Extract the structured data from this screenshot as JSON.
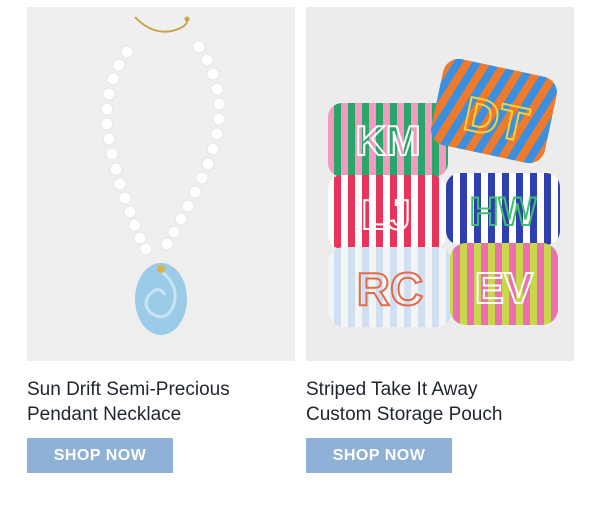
{
  "products": [
    {
      "name_line1": "Sun Drift Semi-Precious",
      "name_line2": "Pendant Necklace",
      "cta": "SHOP NOW",
      "image_icon": "necklace-photo"
    },
    {
      "name_line1": "Striped Take It Away",
      "name_line2": "Custom Storage Pouch",
      "cta": "SHOP NOW",
      "image_icon": "pouches-photo",
      "monograms": [
        "KM",
        "DT",
        "LJ",
        "HW",
        "RC",
        "EV"
      ]
    }
  ],
  "colors": {
    "button_bg": "#8fb1d8",
    "button_text": "#ffffff",
    "image_bg": "#efefef"
  }
}
